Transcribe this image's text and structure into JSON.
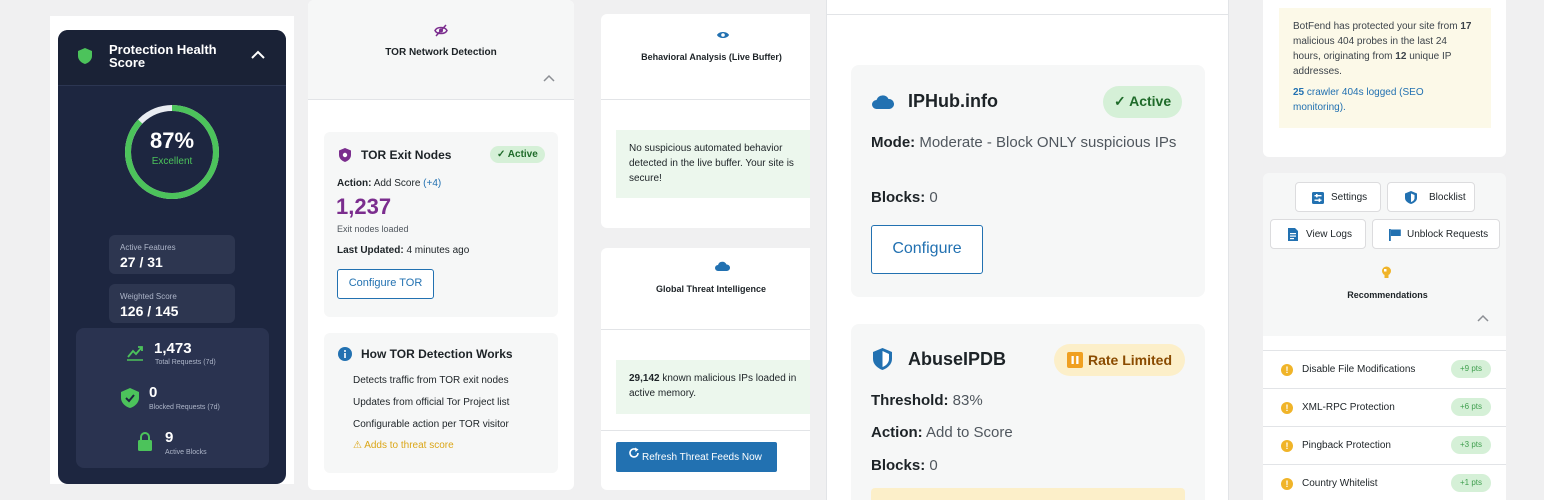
{
  "health": {
    "title": "Protection Health Score",
    "percent": "87%",
    "percent_value": 87,
    "grade": "Excellent",
    "active_features_label": "Active Features",
    "active_features_value": "27 / 31",
    "weighted_score_label": "Weighted Score",
    "weighted_score_value": "126 / 145",
    "total_requests_value": "1,473",
    "total_requests_label": "Total Requests (7d)",
    "blocked_requests_value": "0",
    "blocked_requests_label": "Blocked Requests (7d)",
    "active_blocks_value": "9",
    "active_blocks_label": "Active Blocks"
  },
  "tor": {
    "section_title": "TOR Network Detection",
    "card_title": "TOR Exit Nodes",
    "badge": "✓ Active",
    "action_label": "Action:",
    "action_value": "Add Score",
    "action_score": "(+4)",
    "count": "1,237",
    "count_label": "Exit nodes loaded",
    "updated_label": "Last Updated:",
    "updated_value": "4 minutes ago",
    "configure_button": "Configure TOR",
    "how_title": "How TOR Detection Works",
    "how_items": [
      "Detects traffic from TOR exit nodes",
      "Updates from official Tor Project list",
      "Configurable action per TOR visitor"
    ],
    "warning": "⚠ Adds to threat score"
  },
  "behavior": {
    "section_title": "Behavioral Analysis (Live Buffer)",
    "note": "No suspicious automated behavior detected in the live buffer. Your site is secure!"
  },
  "global": {
    "section_title": "Global Threat Intelligence",
    "count": "29,142",
    "note_rest": "known malicious IPs loaded in active",
    "note_memory": "memory.",
    "refresh_button": "Refresh Threat Feeds Now"
  },
  "iphub": {
    "name": "IPHub.info",
    "badge": "✓ Active",
    "mode_label": "Mode:",
    "mode_value": "Moderate - Block ONLY suspicious IPs",
    "blocks_label": "Blocks:",
    "blocks_value": "0",
    "configure_button": "Configure"
  },
  "abuseipdb": {
    "name": "AbuseIPDB",
    "badge": "Rate Limited",
    "threshold_label": "Threshold:",
    "threshold_value": "83%",
    "action_label": "Action:",
    "action_value": "Add to Score",
    "blocks_label": "Blocks:",
    "blocks_value": "0"
  },
  "summary": {
    "line1": "BotFend has protected your site from",
    "probes": "17",
    "line2": "malicious 404 probes in the last 24 hours, originating from",
    "unique": "12",
    "line3": "unique IP addresses.",
    "crawler_count": "25",
    "crawler_text": "crawler 404s logged (SEO monitoring)."
  },
  "actions": {
    "settings": "Settings",
    "blocklist": "Blocklist",
    "view_logs": "View Logs",
    "unblock_requests": "Unblock Requests"
  },
  "recommendations": {
    "title": "Recommendations",
    "items": [
      {
        "label": "Disable File Modifications",
        "pts": "+9 pts"
      },
      {
        "label": "XML-RPC Protection",
        "pts": "+6 pts"
      },
      {
        "label": "Pingback Protection",
        "pts": "+3 pts"
      },
      {
        "label": "Country Whitelist",
        "pts": "+1 pts"
      }
    ]
  },
  "colors": {
    "navy": "#1d2640",
    "green": "#4cc35b",
    "purple": "#7b2d8e",
    "blue": "#2271b1",
    "amber": "#f0b429"
  }
}
